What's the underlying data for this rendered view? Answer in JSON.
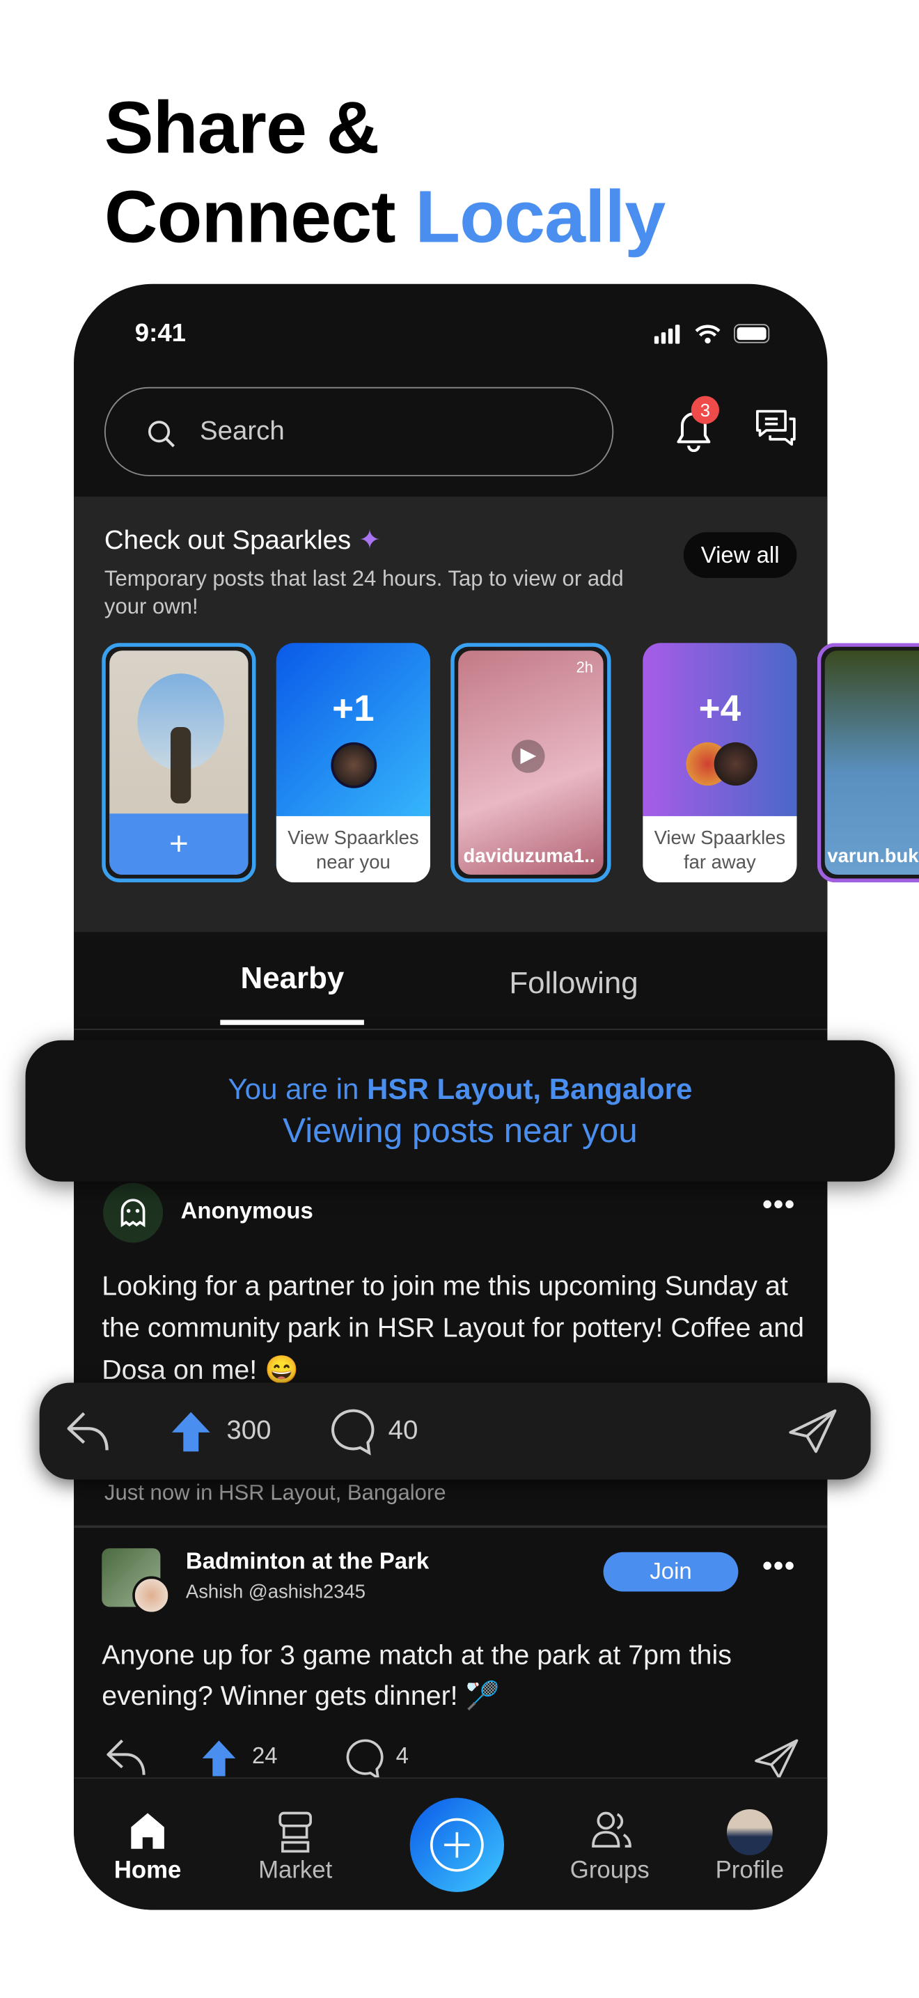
{
  "headline": {
    "line1": "Share &",
    "line2_plain": "Connect ",
    "line2_accent": "Locally",
    "accent_color": "#4a8ff0"
  },
  "status_bar": {
    "time": "9:41"
  },
  "header": {
    "search_placeholder": "Search",
    "notification_count": "3"
  },
  "sparkles": {
    "title": "Check out Spaarkles",
    "description": "Temporary posts that last 24 hours. Tap to view or add your own!",
    "view_all": "View all",
    "cards": [
      {
        "type": "add",
        "label": "+"
      },
      {
        "type": "group",
        "count": "+1",
        "label": "View Spaarkles near you"
      },
      {
        "type": "story",
        "age": "2h",
        "user": "daviduzuma1.."
      },
      {
        "type": "group",
        "count": "+4",
        "label": "View Spaarkles far away"
      },
      {
        "type": "story",
        "user": "varun.buk"
      }
    ]
  },
  "tabs": [
    {
      "label": "Nearby",
      "active": true
    },
    {
      "label": "Following",
      "active": false
    }
  ],
  "location_banner": {
    "prefix": "You are in ",
    "location": "HSR Layout, Bangalore",
    "subtitle": "Viewing posts near you"
  },
  "posts": [
    {
      "author": "Anonymous",
      "text": "Looking for a partner to join me this upcoming Sunday at the community park in HSR Layout for pottery! Coffee and Dosa on me! 😄",
      "upvotes": "300",
      "comments": "40",
      "meta": "Just now in HSR Layout, Bangalore"
    },
    {
      "group": "Badminton at the Park",
      "author": "Ashish @ashish2345",
      "join_label": "Join",
      "text": "Anyone up for 3 game match at the park at 7pm this evening? Winner gets dinner! 🏸",
      "upvotes": "24",
      "comments": "4"
    }
  ],
  "bottom_nav": [
    {
      "label": "Home",
      "active": true
    },
    {
      "label": "Market"
    },
    {
      "label": "Groups"
    },
    {
      "label": "Profile"
    }
  ]
}
